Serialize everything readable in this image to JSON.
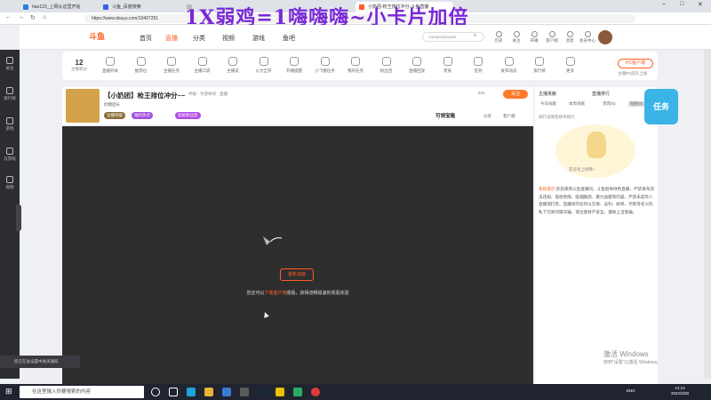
{
  "browser": {
    "tabs": [
      {
        "label": "hao123_上网从这里开始",
        "active": false
      },
      {
        "label": "斗鱼_百度搜索",
        "active": false
      },
      {
        "label": "",
        "active": false
      },
      {
        "label": "小奶团-枪王排位冲分-斗鱼直播",
        "active": true
      }
    ],
    "url": "https://www.douyu.com/10407251",
    "overlay_banner": "1X弱鸡=1嗨嗨嗨~小卡片加倍"
  },
  "site": {
    "logo": "斗鱼",
    "nav": [
      "首页",
      "直播",
      "分类",
      "视频",
      "游戏",
      "鱼吧"
    ],
    "search_placeholder": "orangedaoyuan",
    "header_icons": [
      "历史",
      "关注",
      "开播",
      "客户端",
      "消息",
      "会员中心"
    ]
  },
  "toolbar": {
    "level_number": "12",
    "level_label": "主播积分",
    "items": [
      "直播开关",
      "推荐位",
      "主播任务",
      "主播口袋",
      "主播说",
      "火力全开",
      "开播提醒",
      "小飞猪任务",
      "我的任务",
      "粉丝团",
      "直播回放",
      "贵族",
      "签到",
      "发布动态",
      "排行榜",
      "更多"
    ],
    "pc_button": "PC客户端",
    "pc_sub": "主播PK提升上线"
  },
  "room": {
    "title": "【小奶团】枪王排位冲分~~",
    "category": "举报 · 手游休闲 · 直播",
    "anchor_name": "奶糖团长",
    "follow_label": "关注",
    "fans": "826",
    "badge_1": "主播等级",
    "badge_2": "福利热点",
    "badge_3": "超级粉丝团",
    "gift_label": "可领宝箱",
    "share_label": "分享",
    "report_label": "客户端"
  },
  "player": {
    "reload_label": "重新加载",
    "tip_prefix": "您还可以",
    "tip_highlight": "下载客户端",
    "tip_suffix": "观看，获得流畅极速的观看体验"
  },
  "side_panel": {
    "tab_main": "主播贡献",
    "tab_fans": "直播排行",
    "subtabs": [
      "今日贡献",
      "本周贡献",
      "贵宾(0)",
      "钻粉(0)"
    ],
    "hint": "排行说明及榜单排行",
    "empty_text": "还没有上榜哦~",
    "sys_label": "系统提示:",
    "sys_text": "欢迎来到斗鱼直播间，斗鱼倡导绿色直播，严禁发布违法违规、低俗色情、吸烟酗酒、暴力血腥等内容。严禁未成年人直播或打赏。直播间内任何以交易、返利、刷单、代练等名义的私下交易均属诈骗，请注意财产安全，谨防上当受骗。"
  },
  "windows": {
    "watermark_title": "激活 Windows",
    "watermark_sub": "转到\"设置\"以激活 Windows。",
    "taskbar_search": "在这里输入你要搜索的内容",
    "tray": "ENG",
    "time": "14:13",
    "date": "2022/3/30",
    "notification": "您已在此设置中关闭通知"
  },
  "promo": "任务",
  "colors": {
    "accent": "#ff5d23",
    "banner": "#7a28d8",
    "player_bg": "#2e2e2e",
    "rail_bg": "#2c2d33"
  }
}
